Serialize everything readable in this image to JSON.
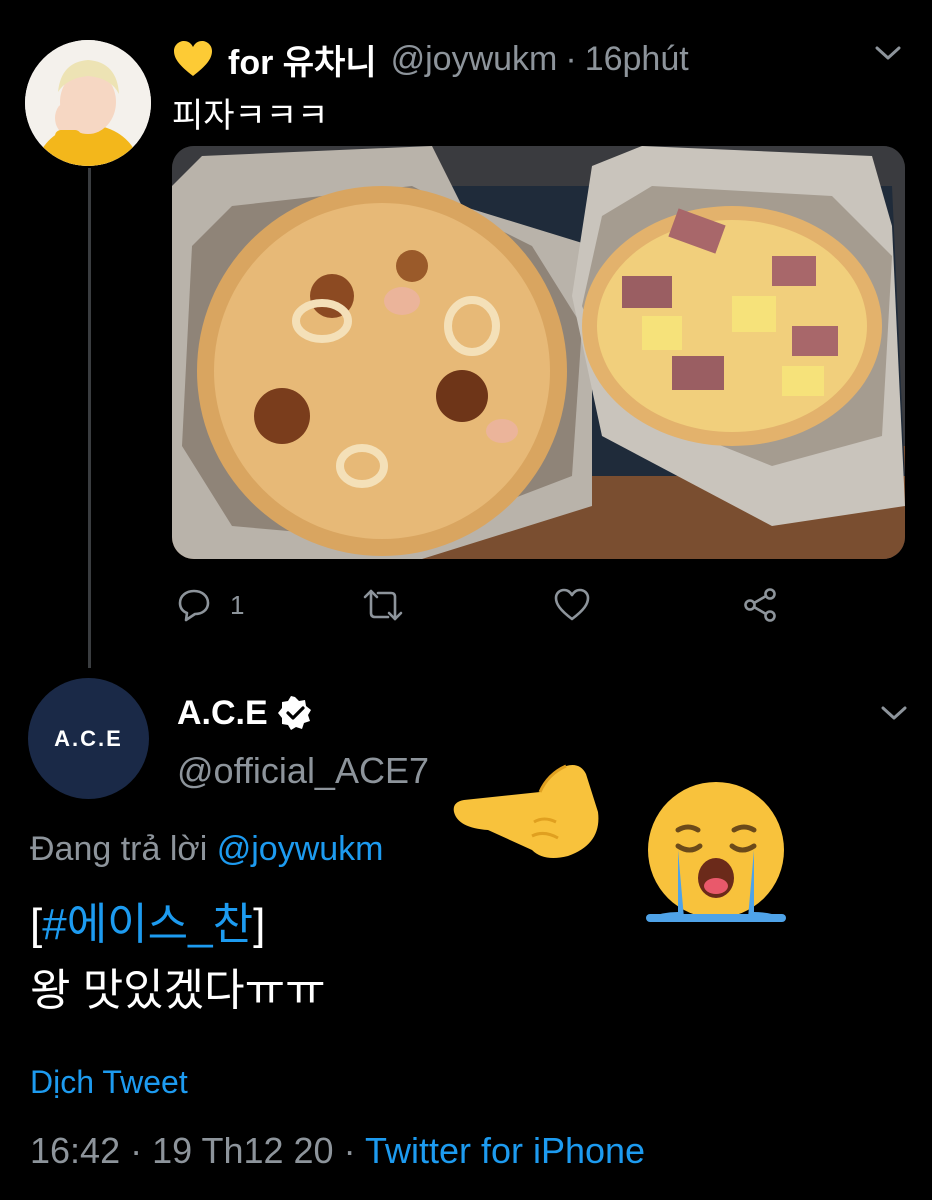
{
  "tweet1": {
    "display_name": "for 유차니",
    "handle": "@joywukm",
    "separator": "·",
    "time": "16phút",
    "text": "피자ㅋㅋㅋ",
    "heart_emoji": "yellow-heart-icon",
    "reply_count": "1",
    "action_icons": [
      "reply-icon",
      "retweet-icon",
      "like-icon",
      "share-icon"
    ]
  },
  "tweet2": {
    "avatar_text": "A.C.E",
    "display_name": "A.C.E",
    "handle": "@official_ACE7",
    "reply_prefix": "Đang trả lời",
    "reply_mention": "@joywukm",
    "body_open_bracket": "[",
    "hashtag": "#에이스_찬",
    "body_close_bracket": "]",
    "body_line2": "왕 맛있겠다ㅠㅠ",
    "translate_label": "Dịch Tweet",
    "timestamp": "16:42 · 19 Th12 20 ·",
    "source_app": "Twitter for iPhone"
  },
  "colors": {
    "background": "#000000",
    "secondary_text": "#8d949b",
    "link": "#1d9bf0",
    "thread_line": "#3a3d40"
  }
}
